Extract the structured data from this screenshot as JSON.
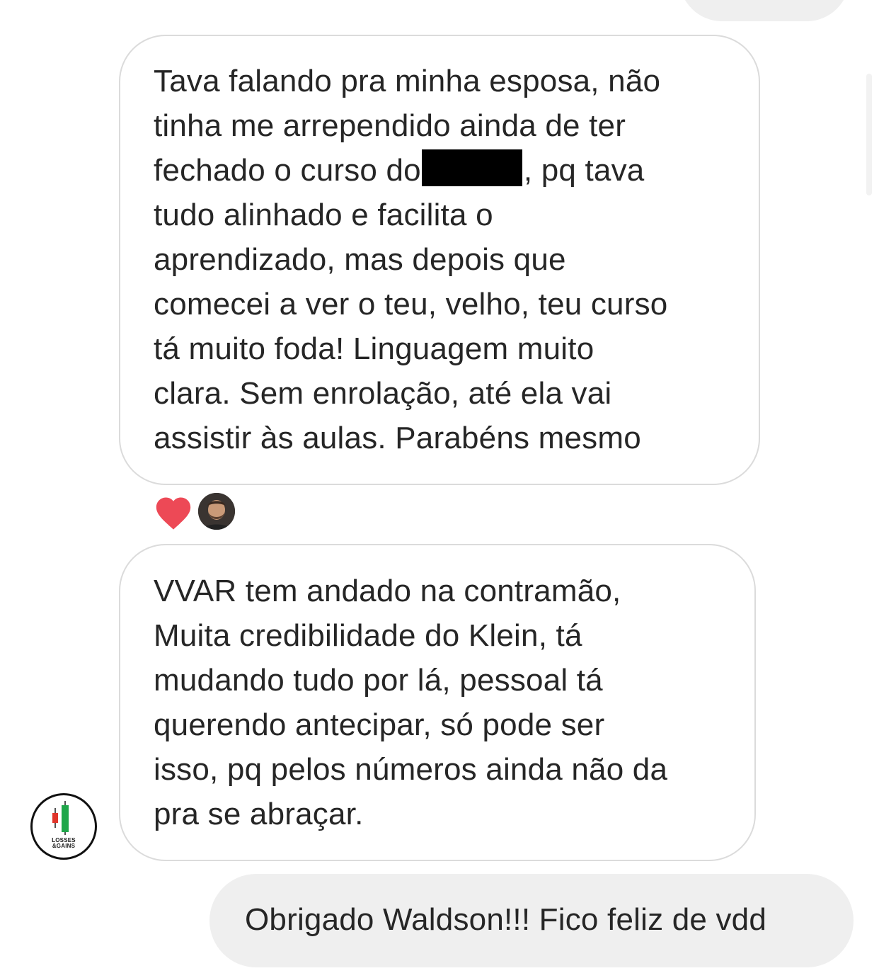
{
  "messages": [
    {
      "direction": "incoming",
      "lines": [
        "Tava falando pra minha esposa, não",
        "tinha me arrependido ainda de ter",
        "fechado o curso do",
        ", pq tava",
        "tudo alinhado e facilita o",
        "aprendizado, mas depois que",
        "comecei a ver o teu, velho, teu curso",
        "tá muito foda! Linguagem muito",
        "clara. Sem enrolação, até ela vai",
        "assistir às aulas. Parabéns mesmo"
      ],
      "reactions": [
        "heart-icon",
        "reactor-avatar"
      ]
    },
    {
      "direction": "incoming",
      "lines": [
        "VVAR tem andado na contramão,",
        "Muita credibilidade do Klein, tá",
        "mudando tudo por lá, pessoal tá",
        "querendo antecipar, só pode ser",
        "isso, pq pelos números ainda não da",
        "pra se abraçar."
      ]
    },
    {
      "direction": "outgoing",
      "lines": [
        "Obrigado Waldson!!! Fico feliz de vdd"
      ]
    }
  ],
  "sender_avatar": {
    "logo_text_line1": "LOSSES",
    "logo_text_line2": "&GAINS",
    "icon": "candlestick-icon"
  },
  "colors": {
    "incoming_border": "#dbdbdb",
    "outgoing_background": "#efefef",
    "text": "#262626",
    "heart": "#ed4956",
    "candle_red": "#e0352b",
    "candle_green": "#1fa64a"
  }
}
